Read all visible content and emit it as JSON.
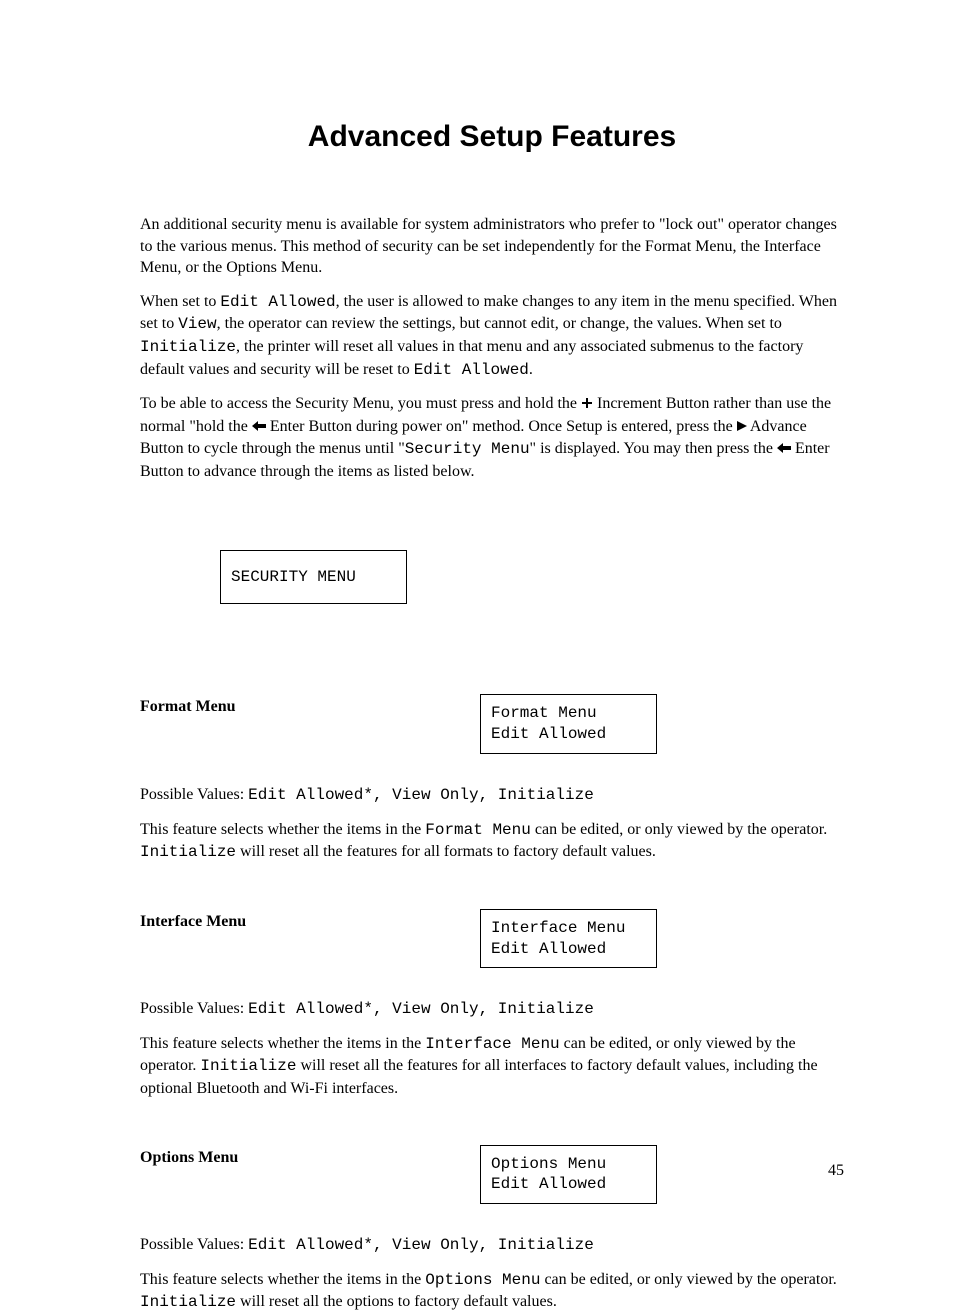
{
  "title": "Advanced Setup Features",
  "para1": "An additional security menu is available for system administrators who prefer to \"lock out\" operator changes to the various menus.  This method of security can be set independently for the Format Menu, the Interface Menu, or the Options Menu.",
  "para2": {
    "t1": "When set to ",
    "edit_allowed": "Edit Allowed",
    "t2": ", the user is allowed to make changes to any item in the menu specified.  When set to ",
    "view": "View",
    "t3": ", the operator can review the settings, but cannot edit, or change, the values.  When set to ",
    "initialize": "Initialize",
    "t4": ", the printer will reset all values in that menu and any associated submenus to the factory default values and security will be reset to ",
    "edit_allowed2": "Edit Allowed",
    "t5": "."
  },
  "para3": {
    "t1": "To be able to access the Security Menu, you must press and hold the ",
    "t2": " Increment Button rather than use the normal \"hold the ",
    "t3": " Enter Button during power on\" method.  Once Setup is entered, press the ",
    "t4": " Advance Button to cycle through the menus until \"",
    "security_menu": "Security Menu",
    "t5": "\" is displayed.  You may then press the ",
    "t6": " Enter Button to advance through the items as listed below."
  },
  "security_menu_box": "SECURITY MENU",
  "possible_values_label": "Possible Values: ",
  "possible_values_list": "Edit Allowed*, View Only, Initialize",
  "sections": {
    "format": {
      "label": "Format Menu",
      "display_l1": "Format Menu",
      "display_l2": "Edit Allowed",
      "desc_t1": "This feature selects whether the items in the ",
      "desc_mono": "Format Menu",
      "desc_t2": " can be edited, or only viewed by the operator.  ",
      "desc_init": "Initialize",
      "desc_t3": " will reset all the features for all formats to factory default values."
    },
    "interface": {
      "label": "Interface Menu",
      "display_l1": "Interface Menu",
      "display_l2": "Edit Allowed",
      "desc_t1": "This feature selects whether the items in the ",
      "desc_mono": "Interface Menu",
      "desc_t2": " can be edited, or only viewed by the operator.  ",
      "desc_init": "Initialize",
      "desc_t3": " will reset all the features for all interfaces to factory default values, including the optional Bluetooth and Wi-Fi interfaces."
    },
    "options": {
      "label": "Options Menu",
      "display_l1": "Options Menu",
      "display_l2": "Edit Allowed",
      "desc_t1": "This feature selects whether the items in the ",
      "desc_mono": "Options Menu",
      "desc_t2": " can be edited, or only viewed by the operator.  ",
      "desc_init": "Initialize",
      "desc_t3": " will reset all the options to factory default values."
    }
  },
  "page_number": "45"
}
